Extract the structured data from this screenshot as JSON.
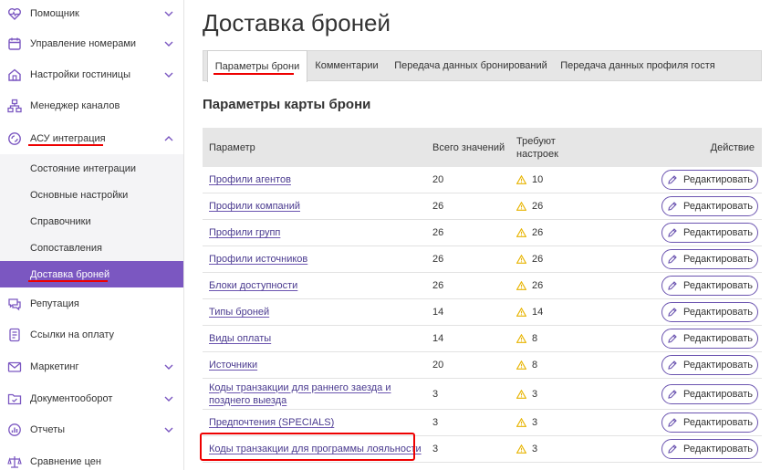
{
  "sidebar": {
    "items": [
      {
        "label": "Помощник",
        "icon": "heart-pulse-icon",
        "chevron": "down"
      },
      {
        "label": "Управление номерами",
        "icon": "calendar-icon",
        "chevron": "down"
      },
      {
        "label": "Настройки гостиницы",
        "icon": "home-icon",
        "chevron": "down"
      },
      {
        "label": "Менеджер каналов",
        "icon": "network-icon",
        "chevron": ""
      },
      {
        "label": "АСУ интеграция",
        "icon": "integration-icon",
        "chevron": "up"
      },
      {
        "label": "Репутация",
        "icon": "chat-icon",
        "chevron": ""
      },
      {
        "label": "Ссылки на оплату",
        "icon": "payment-icon",
        "chevron": ""
      },
      {
        "label": "Маркетинг",
        "icon": "mail-icon",
        "chevron": "down"
      },
      {
        "label": "Документооборот",
        "icon": "folder-icon",
        "chevron": "down"
      },
      {
        "label": "Отчеты",
        "icon": "chart-icon",
        "chevron": "down"
      },
      {
        "label": "Сравнение цен",
        "icon": "scales-icon",
        "chevron": ""
      }
    ],
    "subitems": [
      {
        "label": "Состояние интеграции"
      },
      {
        "label": "Основные настройки"
      },
      {
        "label": "Справочники"
      },
      {
        "label": "Сопоставления"
      },
      {
        "label": "Доставка броней",
        "active": true
      }
    ]
  },
  "main": {
    "title": "Доставка броней",
    "tabs": [
      {
        "label": "Параметры брони",
        "active": true
      },
      {
        "label": "Комментарии"
      },
      {
        "label": "Передача данных бронирований"
      },
      {
        "label": "Передача данных профиля гостя"
      }
    ],
    "section_title": "Параметры карты брони",
    "table": {
      "headers": {
        "param": "Параметр",
        "total": "Всего значений",
        "need_line1": "Требуют",
        "need_line2": "настроек",
        "action": "Действие"
      },
      "edit_label": "Редактировать",
      "rows": [
        {
          "name": "Профили агентов",
          "total": "20",
          "need": "10"
        },
        {
          "name": "Профили компаний",
          "total": "26",
          "need": "26"
        },
        {
          "name": "Профили групп",
          "total": "26",
          "need": "26"
        },
        {
          "name": "Профили источников",
          "total": "26",
          "need": "26"
        },
        {
          "name": "Блоки доступности",
          "total": "26",
          "need": "26"
        },
        {
          "name": "Типы броней",
          "total": "14",
          "need": "14"
        },
        {
          "name": "Виды оплаты",
          "total": "14",
          "need": "8"
        },
        {
          "name": "Источники",
          "total": "20",
          "need": "8"
        },
        {
          "name_line1": "Коды транзакции для раннего заезда и",
          "name_line2": "позднего выезда",
          "total": "3",
          "need": "3"
        },
        {
          "name": "Предпочтения (SPECIALS)",
          "total": "3",
          "need": "3"
        },
        {
          "name": "Коды транзакции для программы лояльности",
          "total": "3",
          "need": "3"
        }
      ]
    }
  },
  "colors": {
    "accent": "#7b57c1",
    "link": "#4a3a8f",
    "warning": "#e8b400",
    "annotation": "#ee0000"
  }
}
